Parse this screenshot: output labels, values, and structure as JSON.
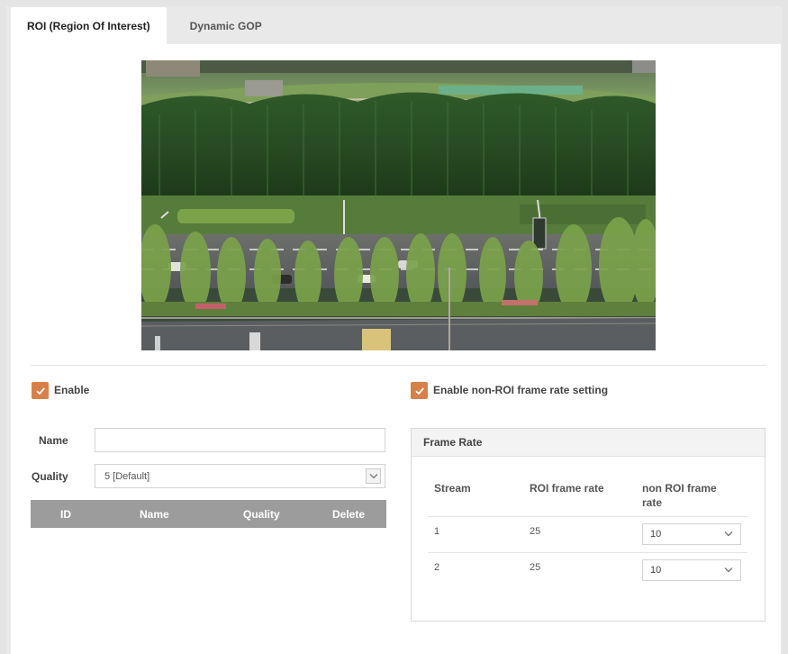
{
  "tabs": [
    {
      "label": "ROI (Region Of Interest)",
      "active": true
    },
    {
      "label": "Dynamic GOP",
      "active": false
    }
  ],
  "roi": {
    "enable_label": "Enable",
    "enabled": true,
    "name_label": "Name",
    "name_value": "",
    "quality_label": "Quality",
    "quality_value": "5 [Default]",
    "table_headers": [
      "ID",
      "Name",
      "Quality",
      "Delete"
    ]
  },
  "non_roi": {
    "enable_label": "Enable non-ROI frame rate setting",
    "enabled": true
  },
  "frame_rate": {
    "title": "Frame Rate",
    "headers": {
      "stream": "Stream",
      "roi_rate": "ROI frame rate",
      "non_roi_rate_line1": "non ROI frame",
      "non_roi_rate_line2": "rate"
    },
    "rows": [
      {
        "stream": "1",
        "roi_rate": "25",
        "non_roi_rate": "10"
      },
      {
        "stream": "2",
        "roi_rate": "25",
        "non_roi_rate": "10"
      }
    ]
  },
  "colors": {
    "accent": "#d8804a",
    "table_header": "#9c9c9c"
  }
}
